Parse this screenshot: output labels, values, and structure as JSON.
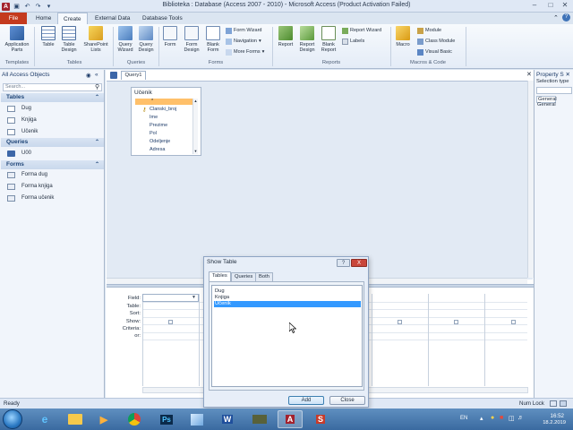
{
  "window": {
    "title": "Biblioteka : Database (Access 2007 - 2010)  -  Microsoft Access (Product Activation Failed)"
  },
  "tabs": [
    "File",
    "Home",
    "Create",
    "External Data",
    "Database Tools"
  ],
  "ribbon": {
    "templates": {
      "app_parts": "Application Parts",
      "group": "Templates"
    },
    "tables": {
      "table": "Table",
      "table_design": "Table Design",
      "sharepoint": "SharePoint Lists",
      "group": "Tables"
    },
    "queries": {
      "wizard": "Query Wizard",
      "design": "Query Design",
      "group": "Queries"
    },
    "forms": {
      "form": "Form",
      "form_design": "Form Design",
      "blank_form": "Blank Form",
      "form_wizard": "Form Wizard",
      "navigation": "Navigation",
      "more_forms": "More Forms",
      "group": "Forms"
    },
    "reports": {
      "report": "Report",
      "report_design": "Report Design",
      "blank_report": "Blank Report",
      "report_wizard": "Report Wizard",
      "labels": "Labels",
      "group": "Reports"
    },
    "macros": {
      "macro": "Macro",
      "module": "Module",
      "class_module": "Class Module",
      "visual_basic": "Visual Basic",
      "group": "Macros & Code"
    }
  },
  "nav": {
    "header": "All Access Objects",
    "search_placeholder": "Search...",
    "tables_label": "Tables",
    "tables": [
      "Dug",
      "Knjiga",
      "Učenik"
    ],
    "queries_label": "Queries",
    "queries": [
      "U00"
    ],
    "forms_label": "Forms",
    "forms": [
      "Forma dug",
      "Forma knjiga",
      "Forma učenik"
    ]
  },
  "doc": {
    "tab": "Query1",
    "table_box": {
      "title": "Učenik",
      "star": "*",
      "fields": [
        "Clanski_broj",
        "Ime",
        "Prezime",
        "Pol",
        "Odeljenje",
        "Adresa"
      ]
    },
    "grid_labels": [
      "Field:",
      "Table:",
      "Sort:",
      "Show:",
      "Criteria:",
      "or:"
    ]
  },
  "props": {
    "title": "Property S",
    "selection": "Selection type",
    "tab1": "General",
    "tab2": "General"
  },
  "status": {
    "left": "Ready",
    "right": "Num Lock"
  },
  "dialog": {
    "title": "Show Table",
    "help": "?",
    "close": "X",
    "tabs": [
      "Tables",
      "Queries",
      "Both"
    ],
    "items": [
      "Dug",
      "Knjiga",
      "Učenik"
    ],
    "selected_index": 2,
    "add": "Add",
    "close_btn": "Close"
  },
  "taskbar": {
    "lang": "EN",
    "time": "16:52",
    "date": "18.2.2019"
  },
  "colors": {
    "file_tab": "#c43a1e",
    "selection": "#3399ff",
    "table_star": "#ffc06a"
  }
}
